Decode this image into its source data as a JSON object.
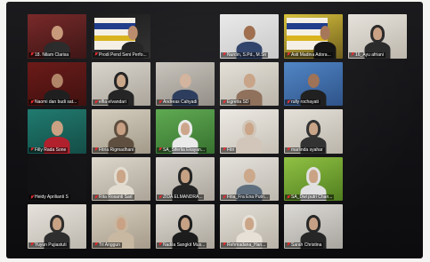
{
  "meeting": {
    "participants": [
      {
        "name": "18. Nilam Clarisa",
        "bg1": "#7a2a2a",
        "bg2": "#3a1212",
        "skin": "#c79a7a",
        "cloth": "#2a2a2a",
        "hijab": "",
        "banner": false
      },
      {
        "name": "Prodi Pend Seni Perfo...",
        "bg1": "#1a1a1a",
        "bg2": "#2d2d2d",
        "skin": "#b98a6a",
        "cloth": "#202020",
        "hijab": "",
        "banner": true
      },
      {
        "name": "",
        "bg1": "#111114",
        "bg2": "#111114",
        "skin": "",
        "cloth": "",
        "hijab": "",
        "banner": false
      },
      {
        "name": "Nurdin, S.Pd., M.Sn",
        "bg1": "#e9e9e9",
        "bg2": "#c7c7c7",
        "skin": "#9c6b4a",
        "cloth": "#2b3e66",
        "hijab": "",
        "banner": false
      },
      {
        "name": "Asti Madina Adora...",
        "bg1": "#d7c13a",
        "bg2": "#6d5c1a",
        "skin": "#a57556",
        "cloth": "#111111",
        "hijab": "",
        "banner": true
      },
      {
        "name": "16_Ayu afriani",
        "bg1": "#e6e2db",
        "bg2": "#bdb7ad",
        "skin": "#caa184",
        "cloth": "#3b3b3b",
        "hijab": "#2a2a2a",
        "banner": false
      },
      {
        "name": "Naomi dan budi sat...",
        "bg1": "#6b1a18",
        "bg2": "#3b0c0a",
        "skin": "#b08466",
        "cloth": "#1c1c1c",
        "hijab": "",
        "banner": false
      },
      {
        "name": "elfia elvandari",
        "bg1": "#d9d4cc",
        "bg2": "#a7a197",
        "skin": "#c9a486",
        "cloth": "#1e1e1e",
        "hijab": "#1e1e1e",
        "banner": false
      },
      {
        "name": "Andreas Cahyadi",
        "bg1": "#c7c3bb",
        "bg2": "#8d8880",
        "skin": "#d1b099",
        "cloth": "#223355",
        "hijab": "",
        "banner": false
      },
      {
        "name": "Egretta SD",
        "bg1": "#e3dfd6",
        "bg2": "#b7b1a6",
        "skin": "#c5a083",
        "cloth": "#8a6a54",
        "hijab": "",
        "banner": false
      },
      {
        "name": "rully rochayati",
        "bg1": "#4b82c4",
        "bg2": "#2a4f86",
        "skin": "#9c6f52",
        "cloth": "#1a1a1a",
        "hijab": "",
        "banner": false
      },
      {
        "name": "",
        "bg1": "#111114",
        "bg2": "#111114",
        "skin": "",
        "cloth": "",
        "hijab": "",
        "banner": false
      },
      {
        "name": "Filly Rada Sone",
        "bg1": "#1f7a6f",
        "bg2": "#0f4a43",
        "skin": "#c9a080",
        "cloth": "#b01e2a",
        "hijab": "",
        "banner": false
      },
      {
        "name": "Fitria Rigmadhani",
        "bg1": "#d6cfbf",
        "bg2": "#9f9685",
        "skin": "#c59c7e",
        "cloth": "#6a5a4a",
        "hijab": "#5a4a3a",
        "banner": false
      },
      {
        "name": "SA_Siferlia Ekayan...",
        "bg1": "#58a64a",
        "bg2": "#2e6b26",
        "skin": "#caa286",
        "cloth": "#e5e5e5",
        "hijab": "#e9e9e9",
        "banner": false
      },
      {
        "name": "Fitri",
        "bg1": "#ece8e2",
        "bg2": "#c4beb4",
        "skin": "#c8a183",
        "cloth": "#d8cdc0",
        "hijab": "#cfc4b6",
        "banner": false
      },
      {
        "name": "marlinda syahar",
        "bg1": "#e4e0d8",
        "bg2": "#b9b3a8",
        "skin": "#c7a285",
        "cloth": "#2d2d2d",
        "hijab": "#2d2d2d",
        "banner": false
      },
      {
        "name": "",
        "bg1": "#111114",
        "bg2": "#111114",
        "skin": "",
        "cloth": "",
        "hijab": "",
        "banner": false
      },
      {
        "name": "Heidy Aprilianti S",
        "bg1": "#121214",
        "bg2": "#121214",
        "skin": "",
        "cloth": "",
        "hijab": "",
        "banner": false
      },
      {
        "name": "Rita Rosanti Sari",
        "bg1": "#dcd6cb",
        "bg2": "#aaa295",
        "skin": "#c9a385",
        "cloth": "#e6e0d4",
        "hijab": "#e2dbcf",
        "banner": false
      },
      {
        "name": "ZIDA ELMANDRA...",
        "bg1": "#d9d5ce",
        "bg2": "#a9a39a",
        "skin": "#c49e80",
        "cloth": "#1f1f1f",
        "hijab": "#1f1f1f",
        "banner": false
      },
      {
        "name": "Fitia_Fra Ena Putri...",
        "bg1": "#e4e1da",
        "bg2": "#bcb7ae",
        "skin": "#caa588",
        "cloth": "#5b6b7b",
        "hijab": "",
        "banner": false
      },
      {
        "name": "SA_Dwi putri Chan...",
        "bg1": "#8dbf3e",
        "bg2": "#4f7d1e",
        "skin": "#c9a183",
        "cloth": "#dcdcdc",
        "hijab": "#e0e0e0",
        "banner": false
      },
      {
        "name": "",
        "bg1": "#111114",
        "bg2": "#111114",
        "skin": "",
        "cloth": "",
        "hijab": "",
        "banner": false
      },
      {
        "name": "Yuyun Pujiastuti",
        "bg1": "#e6e2dc",
        "bg2": "#bdb8ae",
        "skin": "#c8a284",
        "cloth": "#2e2e2e",
        "hijab": "#2e2e2e",
        "banner": false
      },
      {
        "name": "Tri Anggun",
        "bg1": "#d8cfc0",
        "bg2": "#a69b8a",
        "skin": "#c9a285",
        "cloth": "#c9b9a3",
        "hijab": "#c8b8a2",
        "banner": false
      },
      {
        "name": "Nadila Sangkit Mus...",
        "bg1": "#dcd8d1",
        "bg2": "#aba59b",
        "skin": "#c6a083",
        "cloth": "#1b1b1b",
        "hijab": "#1b1b1b",
        "banner": false
      },
      {
        "name": "Rehmadana_Han...",
        "bg1": "#e3ded6",
        "bg2": "#b8b2a7",
        "skin": "#caa487",
        "cloth": "#e9e4dc",
        "hijab": "#e6e0d6",
        "banner": false
      },
      {
        "name": "Sarah Christina",
        "bg1": "#dcdad5",
        "bg2": "#a8a59f",
        "skin": "#c6a084",
        "cloth": "#262626",
        "hijab": "#262626",
        "banner": false
      },
      {
        "name": "",
        "bg1": "#111114",
        "bg2": "#111114",
        "skin": "",
        "cloth": "",
        "hijab": "",
        "banner": false
      },
      {
        "name": "",
        "bg1": "#111114",
        "bg2": "#111114",
        "skin": "",
        "cloth": "",
        "hijab": "",
        "banner": false
      },
      {
        "name": "",
        "bg1": "#111114",
        "bg2": "#111114",
        "skin": "",
        "cloth": "",
        "hijab": "",
        "banner": false
      },
      {
        "name": "",
        "bg1": "#111114",
        "bg2": "#111114",
        "skin": "",
        "cloth": "",
        "hijab": "",
        "banner": false
      },
      {
        "name": "",
        "bg1": "#111114",
        "bg2": "#111114",
        "skin": "",
        "cloth": "",
        "hijab": "",
        "banner": false
      },
      {
        "name": "",
        "bg1": "#111114",
        "bg2": "#111114",
        "skin": "",
        "cloth": "",
        "hijab": "",
        "banner": false
      },
      {
        "name": "",
        "bg1": "#111114",
        "bg2": "#111114",
        "skin": "",
        "cloth": "",
        "hijab": "",
        "banner": false
      }
    ],
    "mic_icon": "mic-muted-icon"
  }
}
